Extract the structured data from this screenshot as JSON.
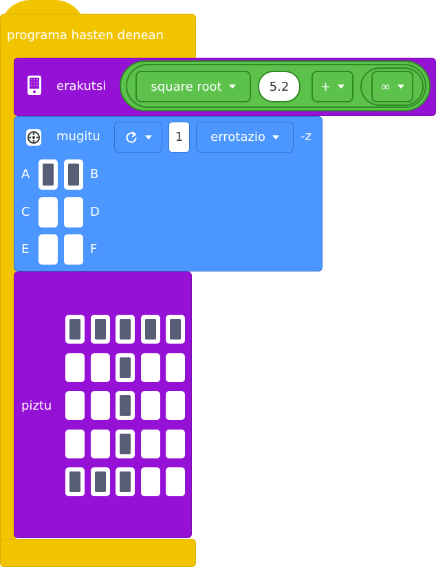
{
  "hat": {
    "label": "programa hasten denean"
  },
  "display_block": {
    "label": "erakutsi",
    "icon": "hub-display-icon",
    "operator_dropdown": "square root",
    "number_value": "5.2",
    "math_operator": "+",
    "constant_dropdown": "∞"
  },
  "move_block": {
    "label": "mugitu",
    "icon": "motor-icon",
    "direction_icon": "rotate-clockwise-icon",
    "amount": "1",
    "unit_dropdown": "errotazio",
    "axis_suffix": "-z",
    "ports": [
      {
        "left": "A",
        "right": "B",
        "left_on": true,
        "right_on": true
      },
      {
        "left": "C",
        "right": "D",
        "left_on": false,
        "right_on": false
      },
      {
        "left": "E",
        "right": "F",
        "left_on": false,
        "right_on": false
      }
    ]
  },
  "light_block": {
    "label": "piztu",
    "matrix": [
      [
        1,
        1,
        1,
        1,
        1
      ],
      [
        0,
        0,
        1,
        0,
        0
      ],
      [
        0,
        0,
        1,
        0,
        0
      ],
      [
        0,
        0,
        1,
        0,
        0
      ],
      [
        1,
        1,
        1,
        0,
        0
      ]
    ]
  },
  "colors": {
    "events": "#f2c400",
    "display": "#9611d6",
    "operators": "#5cc24c",
    "motion": "#4c97ff",
    "led_on": "#575e75"
  }
}
